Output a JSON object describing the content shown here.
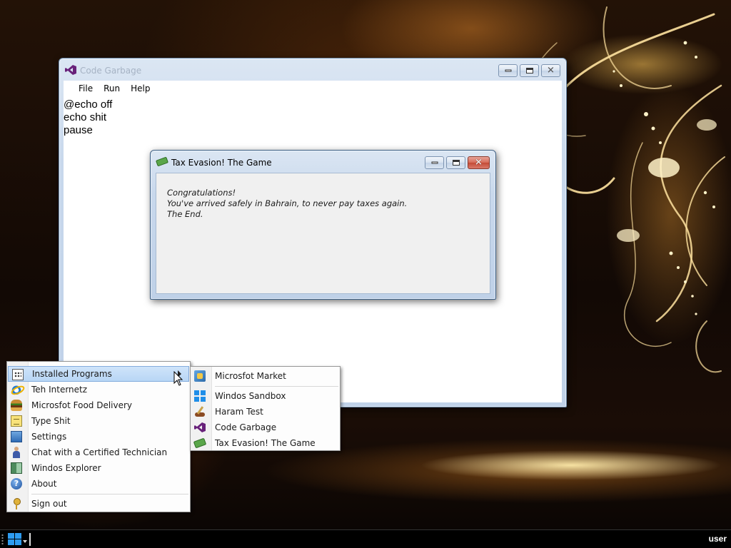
{
  "code_window": {
    "title": "Code Garbage",
    "menu": [
      "File",
      "Run",
      "Help"
    ],
    "code_lines": [
      "@echo off",
      "echo shit",
      "pause"
    ]
  },
  "tax_window": {
    "title": "Tax Evasion! The Game",
    "lines": [
      "Congratulations!",
      "You've arrived safely in Bahrain, to never pay taxes again.",
      "The End."
    ]
  },
  "start_menu": {
    "items": [
      {
        "label": "Installed Programs",
        "icon": "grid-icon",
        "submenu": true
      },
      {
        "label": "Teh Internetz",
        "icon": "ie-icon"
      },
      {
        "label": "Microsfot Food Delivery",
        "icon": "burger-icon"
      },
      {
        "label": "Type Shit",
        "icon": "notepad-icon"
      },
      {
        "label": "Settings",
        "icon": "settings-icon"
      },
      {
        "label": "Chat with a Certified Technician",
        "icon": "person-icon"
      },
      {
        "label": "Windos Explorer",
        "icon": "explorer-icon"
      },
      {
        "label": "About",
        "icon": "about-icon"
      },
      {
        "label": "Sign out",
        "icon": "key-icon"
      }
    ]
  },
  "programs_menu": {
    "items": [
      {
        "label": "Microsfot Market",
        "icon": "market-icon"
      },
      {
        "label": "Windos Sandbox",
        "icon": "windows-icon"
      },
      {
        "label": "Haram Test",
        "icon": "brush-icon"
      },
      {
        "label": "Code Garbage",
        "icon": "visual-studio-icon"
      },
      {
        "label": "Tax Evasion! The Game",
        "icon": "money-icon"
      }
    ]
  },
  "taskbar": {
    "user": "user"
  },
  "colors": {
    "menu_highlight": "#b8d6f5",
    "visual_studio_purple": "#68217a",
    "close_button": "#c44a36"
  }
}
